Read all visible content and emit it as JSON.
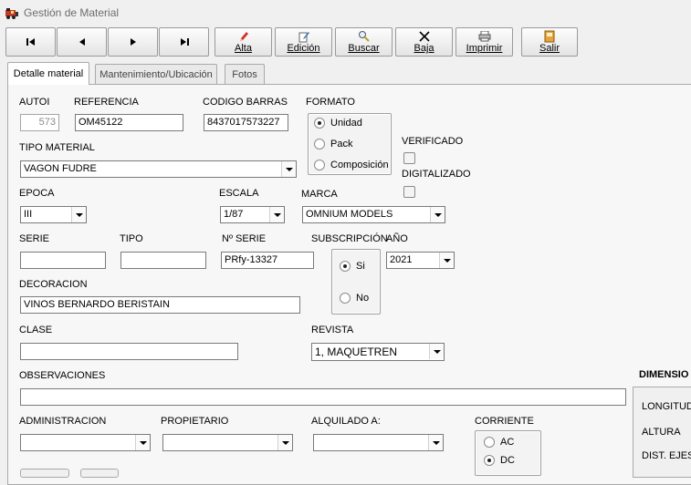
{
  "window": {
    "title": "Gestión de Material"
  },
  "toolbar": {
    "first": "⏮",
    "prev": "◀",
    "next": "▶",
    "last": "⏭",
    "alta": "Alta",
    "edicion": "Edición",
    "buscar": "Buscar",
    "baja": "Baja",
    "imprimir": "Imprimir",
    "salir": "Salir"
  },
  "tabs": [
    "Detalle material",
    "Mantenimiento/Ubicación",
    "Fotos"
  ],
  "form": {
    "autoi_label": "AUTOI",
    "autoi_value": "573",
    "referencia_label": "REFERENCIA",
    "referencia_value": "OM45122",
    "codigo_barras_label": "CODIGO BARRAS",
    "codigo_barras_value": "8437017573227",
    "formato_label": "FORMATO",
    "formato_options": [
      "Unidad",
      "Pack",
      "Composición"
    ],
    "tipo_material_label": "TIPO MATERIAL",
    "tipo_material_value": "VAGON FUDRE",
    "verificado_label": "VERIFICADO",
    "digitalizado_label": "DIGITALIZADO",
    "epoca_label": "EPOCA",
    "epoca_value": "III",
    "escala_label": "ESCALA",
    "escala_value": "1/87",
    "marca_label": "MARCA",
    "marca_value": "OMNIUM MODELS",
    "serie_label": "SERIE",
    "serie_value": "",
    "tipo_label": "TIPO",
    "tipo_value": "",
    "nserie_label": "Nº SERIE",
    "nserie_value": "PRfy-13327",
    "suscripcion_label": "SUBSCRIPCIÓN",
    "suscripcion_options": [
      "Si",
      "No"
    ],
    "anio_label": "AÑO",
    "anio_value": "2021",
    "decoracion_label": "DECORACION",
    "decoracion_value": "VINOS BERNARDO BERISTAIN",
    "clase_label": "CLASE",
    "clase_value": "",
    "revista_label": "REVISTA",
    "revista_value": "1, MAQUETREN",
    "observaciones_label": "OBSERVACIONES",
    "observaciones_value": "",
    "administracion_label": "ADMINISTRACION",
    "propietario_label": "PROPIETARIO",
    "alquilado_label": "ALQUILADO A:",
    "corriente_label": "CORRIENTE",
    "corriente_options": [
      "AC",
      "DC"
    ]
  },
  "dimensiones": {
    "title": "DIMENSIO",
    "longitud": "LONGITUD",
    "altura": "ALTURA",
    "dist_ejes": "DIST. EJES"
  }
}
